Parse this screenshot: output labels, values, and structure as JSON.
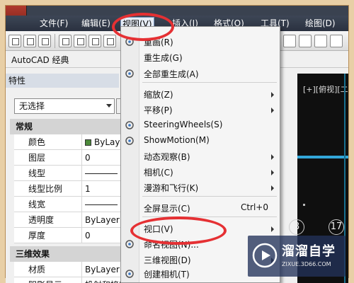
{
  "menubar": {
    "items": [
      "文件(F)",
      "编辑(E)",
      "视图(V)",
      "插入(I)",
      "格式(O)",
      "工具(T)",
      "绘图(D)"
    ],
    "active_index": 2
  },
  "workspace": {
    "label": "AutoCAD 经典"
  },
  "properties": {
    "title": "特性",
    "selection": "无选择",
    "sections": {
      "general": "常规",
      "threed": "三维效果"
    },
    "rows": [
      {
        "name": "颜色",
        "value": "ByLay",
        "swatch": "#4c8a3a"
      },
      {
        "name": "图层",
        "value": "0"
      },
      {
        "name": "线型",
        "value": "",
        "line": true
      },
      {
        "name": "线型比例",
        "value": "1"
      },
      {
        "name": "线宽",
        "value": "",
        "line": true
      },
      {
        "name": "透明度",
        "value": "ByLayer"
      },
      {
        "name": "厚度",
        "value": "0"
      }
    ],
    "threed_rows": [
      {
        "name": "材质",
        "value": "ByLayer"
      },
      {
        "name": "阴影显示",
        "value": "投射和接收"
      }
    ]
  },
  "canvas": {
    "view_label": "[+][俯视][二",
    "bubbles": [
      "8",
      "17"
    ]
  },
  "view_menu": {
    "items": [
      {
        "label": "重画(R)",
        "icon": "redraw-icon"
      },
      {
        "label": "重生成(G)"
      },
      {
        "label": "全部重生成(A)",
        "icon": "regen-all-icon"
      },
      {
        "label": "缩放(Z)",
        "submenu": true
      },
      {
        "label": "平移(P)",
        "submenu": true
      },
      {
        "label": "SteeringWheels(S)",
        "icon": "steering-wheel-icon"
      },
      {
        "label": "ShowMotion(M)",
        "icon": "showmotion-icon"
      },
      {
        "label": "动态观察(B)",
        "submenu": true
      },
      {
        "label": "相机(C)",
        "submenu": true
      },
      {
        "label": "漫游和飞行(K)",
        "submenu": true
      },
      {
        "label": "全屏显示(C)",
        "shortcut": "Ctrl+0"
      },
      {
        "label": "视口(V)",
        "submenu": true
      },
      {
        "label": "命名视图(N)...",
        "icon": "named-view-icon"
      },
      {
        "label": "三维视图(D)",
        "submenu": true
      },
      {
        "label": "创建相机(T)",
        "icon": "camera-icon"
      }
    ]
  },
  "watermark": {
    "title": "溜溜自学",
    "subtitle": "ZIXUE.3D66.COM"
  },
  "colors": {
    "highlight_oval": "#e53033",
    "menubar_bg": "#2f3745",
    "canvas_bg": "#0f0f0f",
    "accent_cyan": "#32a6d8"
  }
}
